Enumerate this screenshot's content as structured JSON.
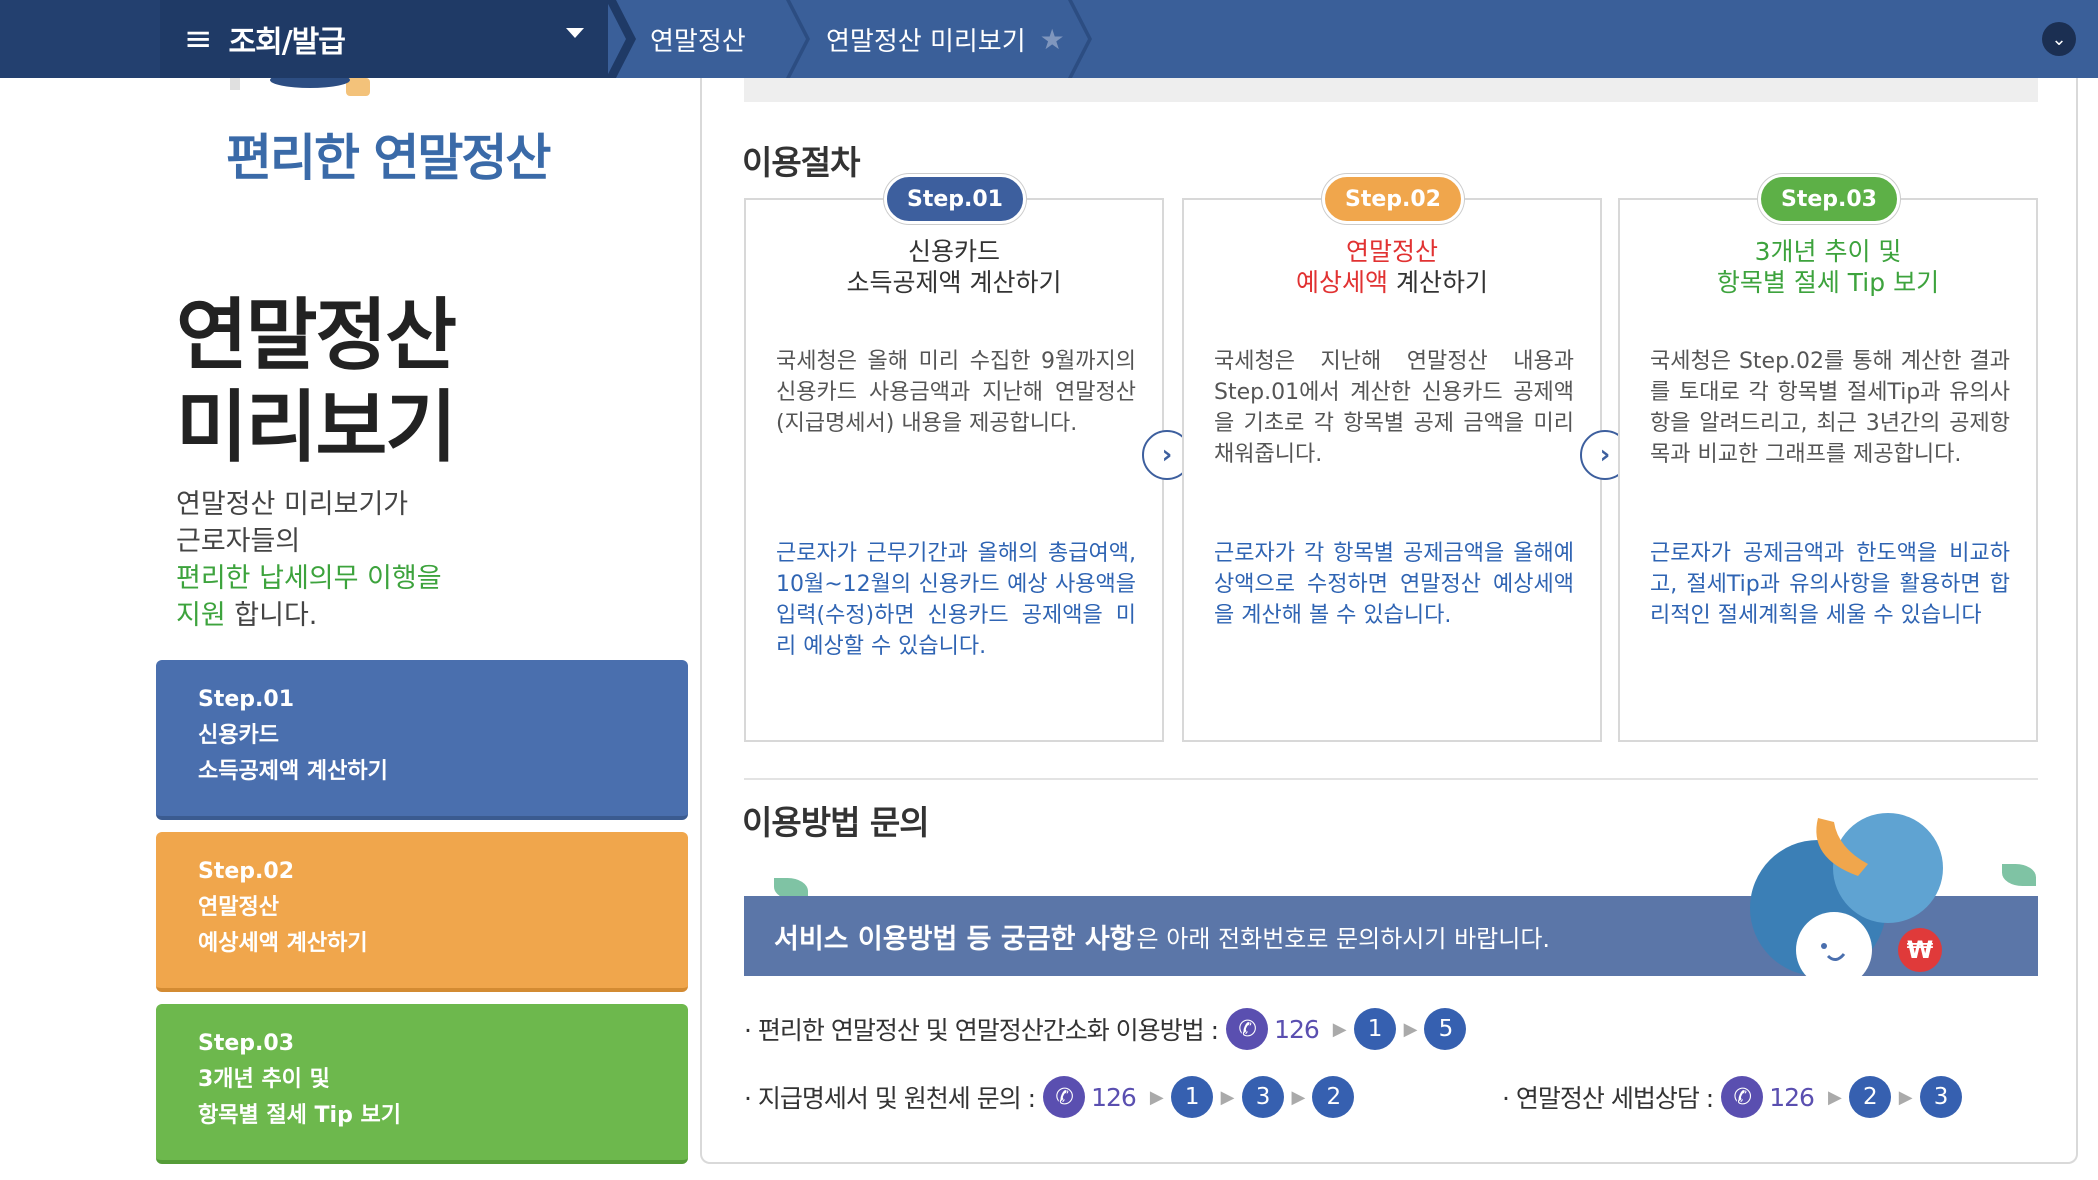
{
  "topnav": {
    "menu_label": "조회/발급",
    "crumbs": [
      "연말정산",
      "연말정산 미리보기"
    ]
  },
  "left": {
    "brand": "편리한 연말정산",
    "title_line1": "연말정산",
    "title_line2": "미리보기",
    "desc_line1": "연말정산 미리보기가",
    "desc_line2": "근로자들의",
    "desc_line3": "편리한 납세의무 이행을",
    "desc_line4_green": "지원",
    "desc_line4_rest": " 합니다.",
    "steps": [
      {
        "step": "Step.01",
        "line1": "신용카드",
        "line2": "소득공제액 계산하기"
      },
      {
        "step": "Step.02",
        "line1": "연말정산",
        "line2": "예상세액 계산하기"
      },
      {
        "step": "Step.03",
        "line1": "3개년 추이 및",
        "line2": "항목별 절세 Tip 보기"
      }
    ]
  },
  "procedure": {
    "title": "이용절차",
    "boxes": [
      {
        "pill": "Step.01",
        "head1": "신용카드",
        "head2": "소득공제액 계산하기",
        "body": "국세청은 올해 미리 수집한 9월까지의 신용카드 사용금액과 지난해 연말정산(지급명세서) 내용을 제공합니다.",
        "blue": "근로자가 근무기간과 올해의 총급여액, 10월~12월의 신용카드 예상 사용액을 입력(수정)하면 신용카드 공제액을 미리 예상할 수 있습니다."
      },
      {
        "pill": "Step.02",
        "head1": "연말정산",
        "head2_red": "예상세액",
        "head2_rest": " 계산하기",
        "body": "국세청은 지난해 연말정산 내용과 Step.01에서 계산한 신용카드 공제액을 기초로 각 항목별 공제 금액을 미리 채워줍니다.",
        "blue": "근로자가 각 항목별 공제금액을 올해예상액으로 수정하면 연말정산 예상세액을 계산해 볼 수 있습니다."
      },
      {
        "pill": "Step.03",
        "head1": "3개년 추이 및",
        "head2": "항목별 절세 Tip 보기",
        "body": "국세청은 Step.02를 통해 계산한 결과를 토대로 각 항목별 절세Tip과 유의사항을 알려드리고, 최근 3년간의 공제항목과 비교한 그래프를 제공합니다.",
        "blue": "근로자가 공제금액과 한도액을 비교하고, 절세Tip과 유의사항을 활용하면 합리적인 절세계획을 세울 수 있습니다"
      }
    ]
  },
  "inquiry": {
    "title": "이용방법 문의",
    "banner_bold": "서비스 이용방법 등 궁금한 사항",
    "banner_rest": "은 아래 전화번호로 문의하시기 바랍니다.",
    "row1_label": "· 편리한 연말정산 및 연말정산간소화 이용방법 :",
    "row1_num": "126",
    "row1_seq": [
      "1",
      "5"
    ],
    "row2_label": "· 지급명세서 및 원천세 문의 :",
    "row2_num": "126",
    "row2_seq": [
      "1",
      "3",
      "2"
    ],
    "row3_label": "· 연말정산 세법상담 :",
    "row3_num": "126",
    "row3_seq": [
      "2",
      "3"
    ]
  },
  "colors": {
    "nav": "#3a5f99",
    "step1": "#4a6fae",
    "step2": "#f0a64c",
    "step3": "#6db84d",
    "banner": "#5b76a8"
  }
}
